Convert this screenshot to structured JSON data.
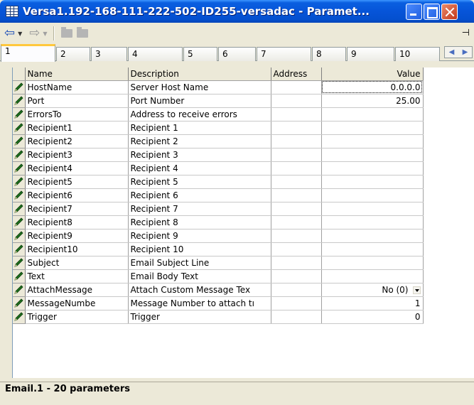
{
  "window": {
    "title": "Versa1.192-168-111-222-502-ID255-versadac - Paramet..."
  },
  "toolbar": {
    "back_icon": "back-arrow-icon",
    "forward_icon": "forward-arrow-icon",
    "pin_icon": "pin-icon"
  },
  "tabs": [
    "1",
    "2",
    "3",
    "4",
    "5",
    "6",
    "7",
    "8",
    "9",
    "10"
  ],
  "grid": {
    "headers": {
      "name": "Name",
      "description": "Description",
      "address": "Address",
      "value": "Value"
    },
    "rows": [
      {
        "name": "HostName",
        "description": "Server Host Name",
        "address": "",
        "value": "0.0.0.0"
      },
      {
        "name": "Port",
        "description": "Port Number",
        "address": "",
        "value": "25.00"
      },
      {
        "name": "ErrorsTo",
        "description": "Address to receive errors",
        "address": "",
        "value": ""
      },
      {
        "name": "Recipient1",
        "description": "Recipient 1",
        "address": "",
        "value": ""
      },
      {
        "name": "Recipient2",
        "description": "Recipient 2",
        "address": "",
        "value": ""
      },
      {
        "name": "Recipient3",
        "description": "Recipient 3",
        "address": "",
        "value": ""
      },
      {
        "name": "Recipient4",
        "description": "Recipient 4",
        "address": "",
        "value": ""
      },
      {
        "name": "Recipient5",
        "description": "Recipient 5",
        "address": "",
        "value": ""
      },
      {
        "name": "Recipient6",
        "description": "Recipient 6",
        "address": "",
        "value": ""
      },
      {
        "name": "Recipient7",
        "description": "Recipient 7",
        "address": "",
        "value": ""
      },
      {
        "name": "Recipient8",
        "description": "Recipient 8",
        "address": "",
        "value": ""
      },
      {
        "name": "Recipient9",
        "description": "Recipient 9",
        "address": "",
        "value": ""
      },
      {
        "name": "Recipient10",
        "description": "Recipient 10",
        "address": "",
        "value": ""
      },
      {
        "name": "Subject",
        "description": "Email Subject Line",
        "address": "",
        "value": ""
      },
      {
        "name": "Text",
        "description": "Email Body Text",
        "address": "",
        "value": ""
      },
      {
        "name": "AttachMessage",
        "description": "Attach Custom Message Tex",
        "address": "",
        "value": "No (0)"
      },
      {
        "name": "MessageNumbe",
        "description": "Message Number to attach tı",
        "address": "",
        "value": "1"
      },
      {
        "name": "Trigger",
        "description": "Trigger",
        "address": "",
        "value": "0"
      }
    ]
  },
  "status": {
    "text": "Email.1  -  20 parameters"
  },
  "colors": {
    "titlebar": "#0654D8",
    "pencil": "#1E6E1E",
    "active_tab_accent": "#FFC83C"
  }
}
